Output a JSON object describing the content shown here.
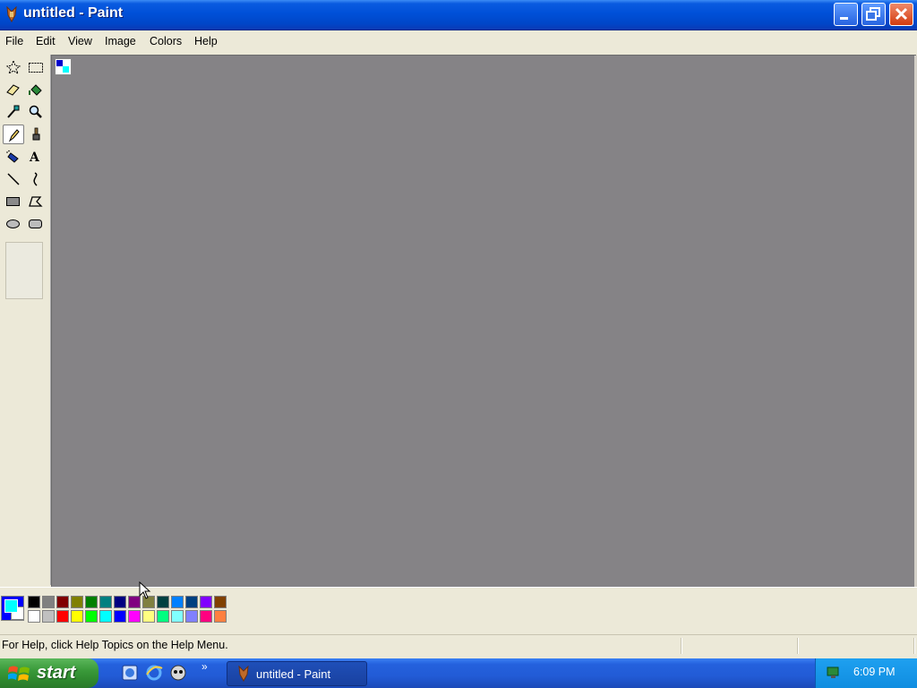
{
  "window": {
    "title": "untitled - Paint"
  },
  "menu": [
    {
      "id": "file",
      "label": "File"
    },
    {
      "id": "edit",
      "label": "Edit"
    },
    {
      "id": "view",
      "label": "View"
    },
    {
      "id": "image",
      "label": "Image"
    },
    {
      "id": "colors",
      "label": "Colors"
    },
    {
      "id": "help",
      "label": "Help"
    }
  ],
  "tools": [
    {
      "name": "free-form-select",
      "icon": "free-select-icon",
      "selected": false
    },
    {
      "name": "select",
      "icon": "rect-select-icon",
      "selected": false
    },
    {
      "name": "eraser",
      "icon": "eraser-icon",
      "selected": false
    },
    {
      "name": "fill-with-color",
      "icon": "paint-bucket-icon",
      "selected": false
    },
    {
      "name": "pick-color",
      "icon": "eyedropper-icon",
      "selected": false
    },
    {
      "name": "magnifier",
      "icon": "magnifier-icon",
      "selected": false
    },
    {
      "name": "pencil",
      "icon": "pencil-icon",
      "selected": true
    },
    {
      "name": "brush",
      "icon": "brush-icon",
      "selected": false
    },
    {
      "name": "airbrush",
      "icon": "airbrush-icon",
      "selected": false
    },
    {
      "name": "text",
      "icon": "text-icon",
      "selected": false
    },
    {
      "name": "line",
      "icon": "line-icon",
      "selected": false
    },
    {
      "name": "curve",
      "icon": "curve-icon",
      "selected": false
    },
    {
      "name": "rectangle",
      "icon": "rectangle-icon",
      "selected": false
    },
    {
      "name": "polygon",
      "icon": "polygon-icon",
      "selected": false
    },
    {
      "name": "ellipse",
      "icon": "ellipse-icon",
      "selected": false
    },
    {
      "name": "rounded-rectangle",
      "icon": "rounded-rect-icon",
      "selected": false
    }
  ],
  "colors": {
    "foreground": "#00ffff",
    "background": "#ffffff",
    "indicator_frame": "#0000ff",
    "palette_top": [
      "#000000",
      "#808080",
      "#800000",
      "#808000",
      "#008000",
      "#008080",
      "#000080",
      "#800080",
      "#808040",
      "#004040",
      "#0080ff",
      "#004080",
      "#8000ff",
      "#804000"
    ],
    "palette_bottom": [
      "#ffffff",
      "#c0c0c0",
      "#ff0000",
      "#ffff00",
      "#00ff00",
      "#00ffff",
      "#0000ff",
      "#ff00ff",
      "#ffff80",
      "#00ff80",
      "#80ffff",
      "#8080ff",
      "#ff0080",
      "#ff8040"
    ]
  },
  "status": {
    "help_text": "For Help, click Help Topics on the Help Menu."
  },
  "taskbar": {
    "start_label": "start",
    "quick_launch": [
      "ie-app-icon",
      "internet-explorer-icon",
      "media-player-icon"
    ],
    "chevron": "»",
    "task_label": "untitled - Paint",
    "clock": "6:09 PM"
  }
}
